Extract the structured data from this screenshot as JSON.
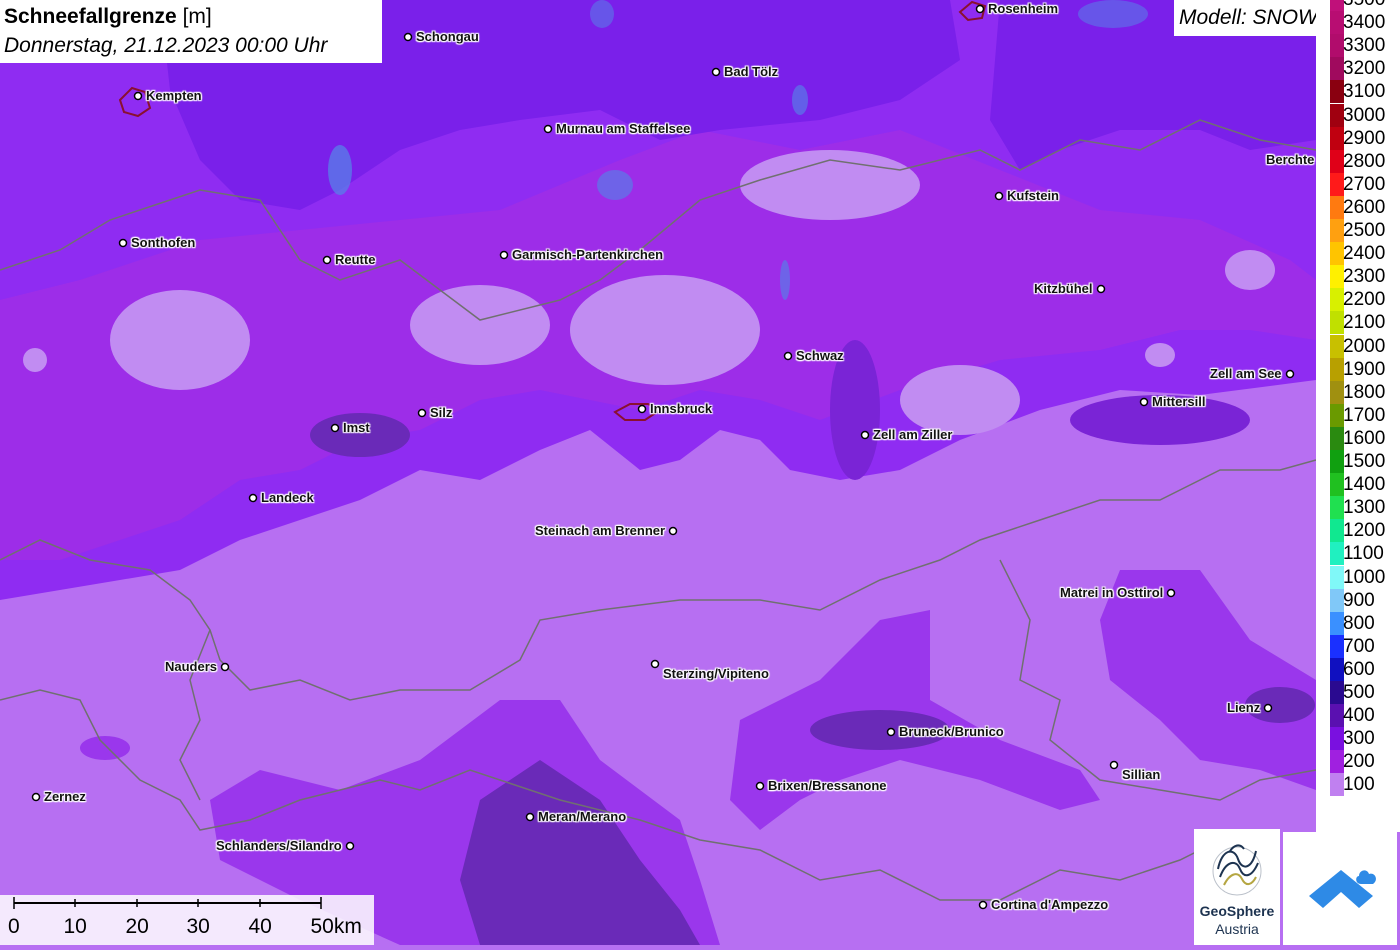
{
  "title": {
    "variable": "Schneefallgrenze",
    "unit": "[m]",
    "datetime": "Donnerstag, 21.12.2023 00:00 Uhr"
  },
  "model": "Modell: SNOWGRID",
  "legend": [
    {
      "label": "3500",
      "color": "#c0107a"
    },
    {
      "label": "3400",
      "color": "#b80d72"
    },
    {
      "label": "3300",
      "color": "#b10c6c"
    },
    {
      "label": "3200",
      "color": "#a00a5e"
    },
    {
      "label": "3100",
      "color": "#8a0010"
    },
    {
      "label": "3000",
      "color": "#a00010"
    },
    {
      "label": "2900",
      "color": "#c00010"
    },
    {
      "label": "2800",
      "color": "#e00018"
    },
    {
      "label": "2700",
      "color": "#ff1a1a"
    },
    {
      "label": "2600",
      "color": "#ff7a10"
    },
    {
      "label": "2500",
      "color": "#ffa010"
    },
    {
      "label": "2400",
      "color": "#ffc400"
    },
    {
      "label": "2300",
      "color": "#fff000"
    },
    {
      "label": "2200",
      "color": "#d8f000"
    },
    {
      "label": "2100",
      "color": "#c0e000"
    },
    {
      "label": "2000",
      "color": "#c8c000"
    },
    {
      "label": "1900",
      "color": "#b8a000"
    },
    {
      "label": "1800",
      "color": "#a09010"
    },
    {
      "label": "1700",
      "color": "#6a9a00"
    },
    {
      "label": "1600",
      "color": "#2a8a10"
    },
    {
      "label": "1500",
      "color": "#10a010"
    },
    {
      "label": "1400",
      "color": "#20c020"
    },
    {
      "label": "1300",
      "color": "#20e050"
    },
    {
      "label": "1200",
      "color": "#10e890"
    },
    {
      "label": "1100",
      "color": "#20f0c0"
    },
    {
      "label": "1000",
      "color": "#80f8f8"
    },
    {
      "label": "900",
      "color": "#80c8f8"
    },
    {
      "label": "800",
      "color": "#3a90ff"
    },
    {
      "label": "700",
      "color": "#1a30ff"
    },
    {
      "label": "600",
      "color": "#1010c0"
    },
    {
      "label": "500",
      "color": "#2a0a90"
    },
    {
      "label": "400",
      "color": "#5a10b0"
    },
    {
      "label": "300",
      "color": "#7a10e0"
    },
    {
      "label": "200",
      "color": "#a020e0"
    },
    {
      "label": "100",
      "color": "#c080f0"
    }
  ],
  "cities": [
    {
      "name": "Rosenheim"
    },
    {
      "name": "Schongau"
    },
    {
      "name": "Kempten"
    },
    {
      "name": "Bad Tölz"
    },
    {
      "name": "Murnau am Staffelsee"
    },
    {
      "name": "Berchte"
    },
    {
      "name": "Kufstein"
    },
    {
      "name": "Sonthofen"
    },
    {
      "name": "Reutte"
    },
    {
      "name": "Garmisch-Partenkirchen"
    },
    {
      "name": "Kitzbühel"
    },
    {
      "name": "Schwaz"
    },
    {
      "name": "Zell am See"
    },
    {
      "name": "Mittersill"
    },
    {
      "name": "Silz"
    },
    {
      "name": "Innsbruck"
    },
    {
      "name": "Imst"
    },
    {
      "name": "Zell am Ziller"
    },
    {
      "name": "Landeck"
    },
    {
      "name": "Steinach am Brenner"
    },
    {
      "name": "Matrei in Osttirol"
    },
    {
      "name": "Nauders"
    },
    {
      "name": "Sterzing/Vipiteno"
    },
    {
      "name": "Lienz"
    },
    {
      "name": "Bruneck/Brunico"
    },
    {
      "name": "Sillian"
    },
    {
      "name": "Zernez"
    },
    {
      "name": "Brixen/Bressanone"
    },
    {
      "name": "Meran/Merano"
    },
    {
      "name": "Schlanders/Silandro"
    },
    {
      "name": "Cortina d'Ampezzo"
    }
  ],
  "scale": [
    "0",
    "10",
    "20",
    "30",
    "40",
    "50km"
  ],
  "logo": {
    "name": "GeoSphere",
    "sub": "Austria"
  },
  "colors": {
    "base": "#b76ff2",
    "mid": "#9a37ec",
    "high": "#7d1ff0",
    "higher": "#6a1fd8",
    "highest": "#5a189a",
    "magenta": "#a030e0",
    "borders": "#707070",
    "lakes": "#5a7ae8"
  }
}
